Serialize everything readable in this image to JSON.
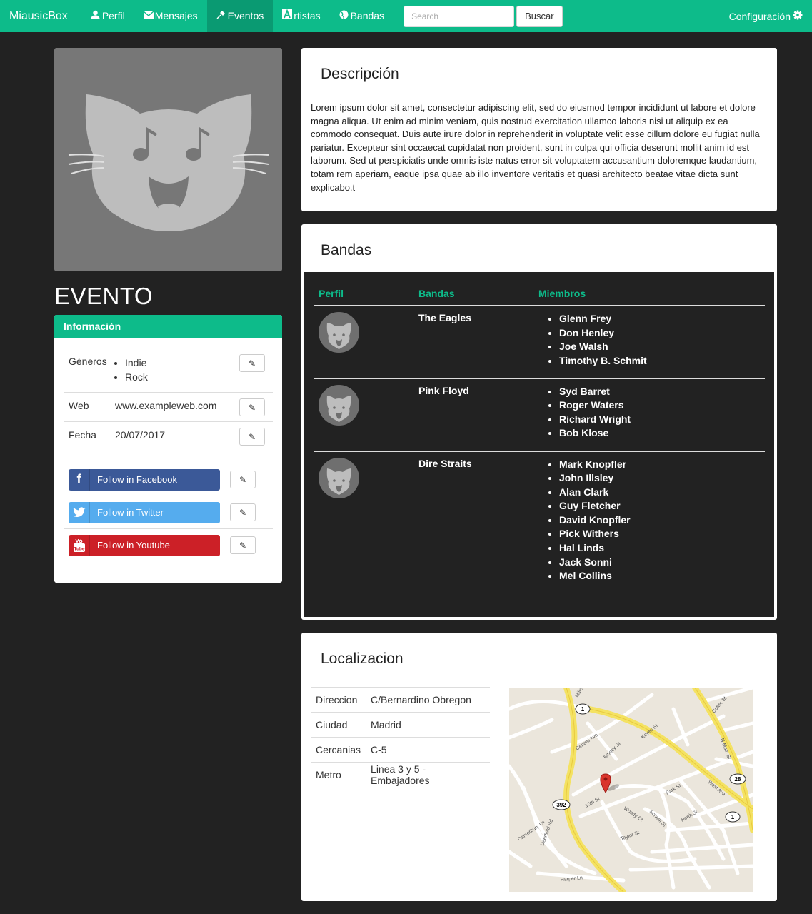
{
  "navbar": {
    "brand": "MiausicBox",
    "items": [
      {
        "label": "Perfil",
        "icon": "user-icon",
        "active": false
      },
      {
        "label": "Mensajes",
        "icon": "envelope-icon",
        "active": false
      },
      {
        "label": "Eventos",
        "icon": "pushpin-icon",
        "active": true
      },
      {
        "label": "rtistas",
        "icon": "font-a-icon",
        "active": false
      },
      {
        "label": "Bandas",
        "icon": "globe-icon",
        "active": false
      }
    ],
    "search_placeholder": "Search",
    "search_button": "Buscar",
    "config_label": "Configuración",
    "accent_color": "#0dbb8a"
  },
  "event": {
    "title": "EVENTO",
    "info_header": "Información",
    "generos_label": "Géneros",
    "generos": [
      "Indie",
      "Rock"
    ],
    "web_label": "Web",
    "web_value": "www.exampleweb.com",
    "fecha_label": "Fecha",
    "fecha_value": "20/07/2017",
    "social": {
      "facebook": "Follow in Facebook",
      "twitter": "Follow in Twitter",
      "youtube": "Follow in Youtube"
    }
  },
  "descripcion": {
    "title": "Descripción",
    "text": "Lorem ipsum dolor sit amet, consectetur adipiscing elit, sed do eiusmod tempor incididunt ut labore et dolore magna aliqua. Ut enim ad minim veniam, quis nostrud exercitation ullamco laboris nisi ut aliquip ex ea commodo consequat. Duis aute irure dolor in reprehenderit in voluptate velit esse cillum dolore eu fugiat nulla pariatur. Excepteur sint occaecat cupidatat non proident, sunt in culpa qui officia deserunt mollit anim id est laborum. Sed ut perspiciatis unde omnis iste natus error sit voluptatem accusantium doloremque laudantium, totam rem aperiam, eaque ipsa quae ab illo inventore veritatis et quasi architecto beatae vitae dicta sunt explicabo.t"
  },
  "bandas": {
    "title": "Bandas",
    "headers": {
      "perfil": "Perfil",
      "bandas": "Bandas",
      "miembros": "Miembros"
    },
    "rows": [
      {
        "name": "The Eagles",
        "members": [
          "Glenn Frey",
          "Don Henley",
          "Joe Walsh",
          "Timothy B. Schmit"
        ]
      },
      {
        "name": "Pink Floyd",
        "members": [
          "Syd Barret",
          "Roger Waters",
          "Richard Wright",
          "Bob Klose"
        ]
      },
      {
        "name": "Dire Straits",
        "members": [
          "Mark Knopfler",
          "John Illsley",
          "Alan Clark",
          "Guy Fletcher",
          "David Knopfler",
          "Pick Withers",
          "Hal Linds",
          "Jack Sonni",
          "Mel Collins"
        ]
      }
    ]
  },
  "localizacion": {
    "title": "Localizacion",
    "rows": [
      {
        "label": "Direccion",
        "value": "C/Bernardino Obregon"
      },
      {
        "label": "Ciudad",
        "value": "Madrid"
      },
      {
        "label": "Cercanias",
        "value": "C-5"
      },
      {
        "label": "Metro",
        "value": "Linea 3 y 5 - Embajadores"
      }
    ],
    "map_labels": {
      "route_1": "1",
      "route_392": "392",
      "route_28": "28",
      "route_1b": "1",
      "miller_ave": "Miller Ave",
      "main_st": "N Main St",
      "west_ave": "West Ave",
      "central_ave": "Central Ave",
      "keyes_st": "Keyes St",
      "bibney_st": "Bibney St",
      "cotter_st": "Cotter St",
      "tenth_st": "10th St",
      "woody_ct": "Woody Ct",
      "park_st": "Park St",
      "school_st": "School St",
      "north_st": "North St",
      "taylor_st": "Taylor St",
      "harper_ln": "Harper Ln",
      "deerfield_rd": "Deerfield Rd",
      "canterbury_ln": "Canterbury Ln"
    }
  }
}
